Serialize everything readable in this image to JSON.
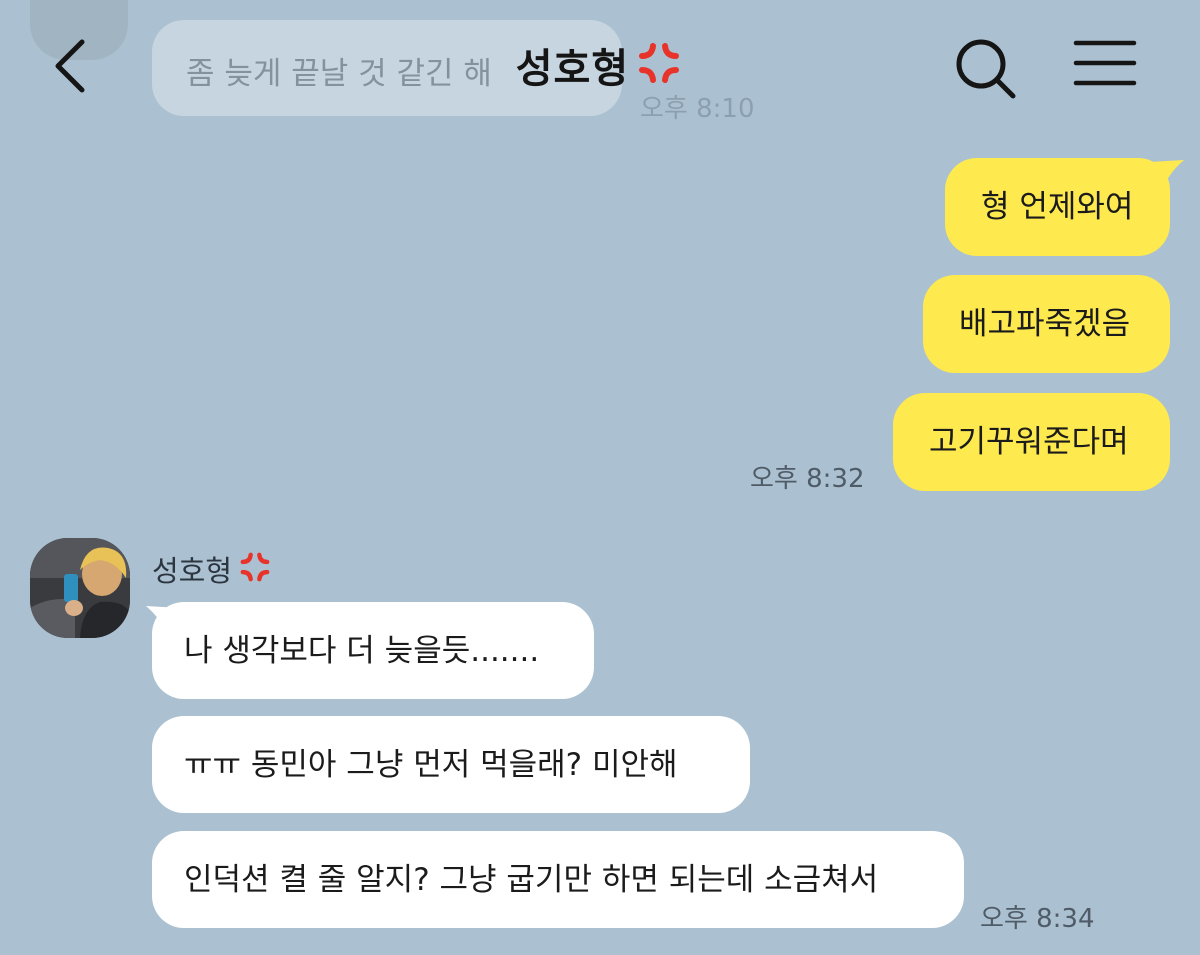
{
  "header": {
    "title": "성호형",
    "title_emoji": "anger-symbol-icon",
    "back": "back-chevron-icon",
    "search": "search-icon",
    "menu": "menu-icon"
  },
  "faded_message": {
    "text": "좀 늦게 끝날 것 같긴 해",
    "time": "오후 8:10"
  },
  "my_messages": [
    {
      "text": "형 언제와여"
    },
    {
      "text": "배고파죽겠음"
    },
    {
      "text": "고기꾸워준다며"
    }
  ],
  "my_time": "오후 8:32",
  "other": {
    "name": "성호형",
    "messages": [
      {
        "text": "나 생각보다 더 늦을듯......."
      },
      {
        "text": "ㅠㅠ 동민아 그냥 먼저 먹을래? 미안해"
      },
      {
        "text": "인덕션 켤 줄 알지? 그냥 굽기만 하면 되는데 소금쳐서"
      }
    ],
    "time": "오후 8:34"
  },
  "colors": {
    "background": "#abc1d1",
    "my_bubble": "#fee94e",
    "their_bubble": "#ffffff",
    "anger_emoji": "#e8332a"
  }
}
